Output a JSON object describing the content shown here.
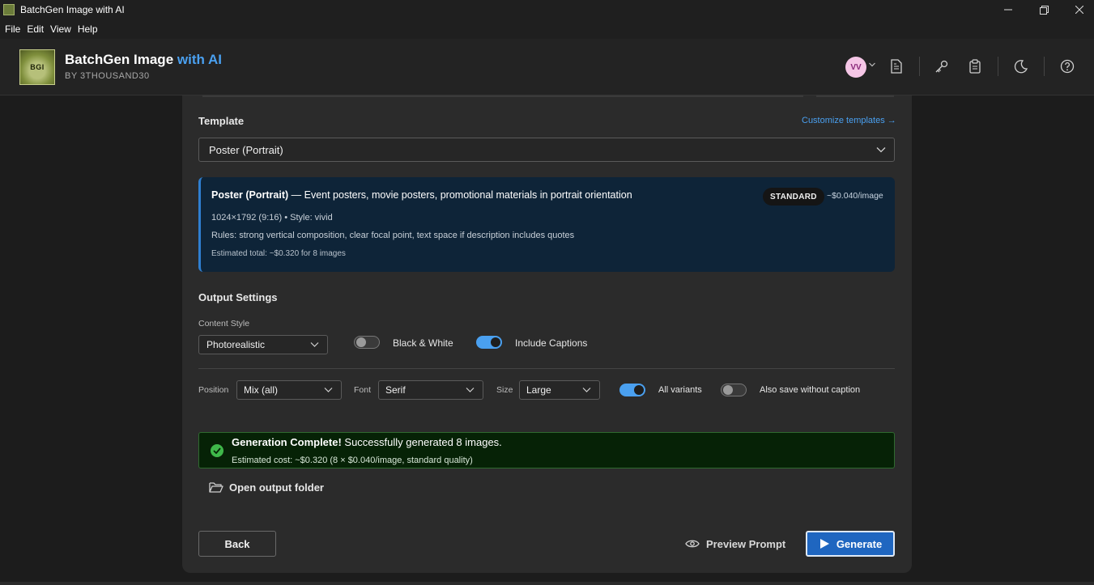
{
  "window": {
    "title": "BatchGen Image with AI",
    "controls": {
      "minimize": "—",
      "maximize": "❐",
      "close": "✕"
    }
  },
  "menu": [
    "File",
    "Edit",
    "View",
    "Help"
  ],
  "header": {
    "logo_text": "BGI",
    "brand_main": "BatchGen Image",
    "brand_accent": "with AI",
    "subtitle": "BY 3THOUSAND30",
    "avatar_initials": "VV",
    "icons": [
      "document-icon",
      "key-icon",
      "clipboard-icon",
      "moon-icon",
      "help-icon"
    ]
  },
  "template": {
    "label": "Template",
    "customize_link": "Customize templates →",
    "selected": "Poster (Portrait)",
    "info": {
      "name": "Poster (Portrait)",
      "description": " — Event posters, movie posters, promotional materials in portrait orientation",
      "badge": "STANDARD",
      "price": "~$0.040/image",
      "spec": "1024×1792 (9:16) • Style: vivid",
      "rules": "Rules: strong vertical composition, clear focal point, text space if description includes quotes",
      "estimate": "Estimated total: ~$0.320 for 8 images"
    }
  },
  "output": {
    "heading": "Output Settings",
    "content_style_label": "Content Style",
    "content_style_value": "Photorealistic",
    "bw_label": "Black & White",
    "bw_on": false,
    "captions_label": "Include Captions",
    "captions_on": true,
    "position_label": "Position",
    "position_value": "Mix (all)",
    "font_label": "Font",
    "font_value": "Serif",
    "size_label": "Size",
    "size_value": "Large",
    "all_variants_label": "All variants",
    "all_variants_on": true,
    "no_caption_label": "Also save without caption",
    "no_caption_on": false
  },
  "status": {
    "title_bold": "Generation Complete!",
    "title_rest": " Successfully generated 8 images.",
    "cost": "Estimated cost: ~$0.320 (8 × $0.040/image, standard quality)"
  },
  "actions": {
    "open_folder": "Open output folder",
    "back": "Back",
    "preview": "Preview Prompt",
    "generate": "Generate"
  },
  "colors": {
    "accent": "#4aa0f0",
    "info_bg": "#0e2438",
    "success_bg": "#062206",
    "success_icon": "#3fb84a",
    "primary_button": "#1f66c0"
  }
}
